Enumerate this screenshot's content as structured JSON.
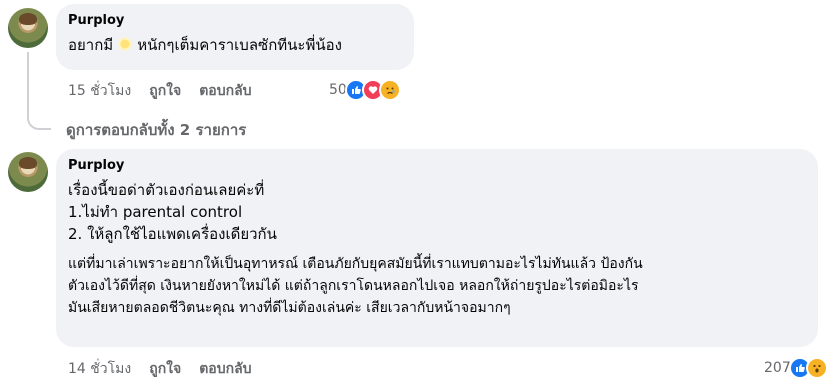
{
  "comments": [
    {
      "author": "Purploy",
      "text_before": "อยากมี",
      "text_after": "หนักๆเต็มคาราเบลซักทีนะพี่น้อง",
      "time": "15 ชั่วโมง",
      "like_label": "ถูกใจ",
      "reply_label": "ตอบกลับ",
      "reaction_count": "50",
      "reaction_icons": [
        "like-icon",
        "love-icon",
        "sad-icon"
      ]
    },
    {
      "author": "Purploy",
      "lines": [
        "เรื่องนี้ขอด่าตัวเองก่อนเลยค่ะที่",
        "1.ไม่ทำ parental control",
        "2. ให้ลูกใช้ไอแพดเครื่องเดียวกัน",
        "",
        "แต่ที่มาเล่าเพราะอยากให้เป็นอุทาหรณ์ เตือนภัยกับยุคสมัยนี้ที่เราแทบตามอะไรไม่ทันแล้ว ป้องกัน",
        "ตัวเองไว้ดีที่สุด เงินหายยังหาใหม่ได้ แต่ถ้าลูกเราโดนหลอกไปเจอ หลอกให้ถ่ายรูปอะไรต่อมิอะไร",
        "มันเสียหายตลอดชีวิตนะคุณ ทางที่ดีไม่ต้องเล่นค่ะ เสียเวลากับหน้าจอมากๆ"
      ],
      "time": "14 ชั่วโมง",
      "like_label": "ถูกใจ",
      "reply_label": "ตอบกลับ",
      "reaction_count": "207",
      "reaction_icons": [
        "like-icon",
        "wow-icon"
      ]
    }
  ],
  "view_replies": "ดูการตอบกลับทั้ง 2 รายการ",
  "colors": {
    "bubble": "#f0f2f5",
    "muted": "#65676b",
    "like": "#1877f2",
    "love": "#f33e58",
    "sad": "#f7b125"
  }
}
